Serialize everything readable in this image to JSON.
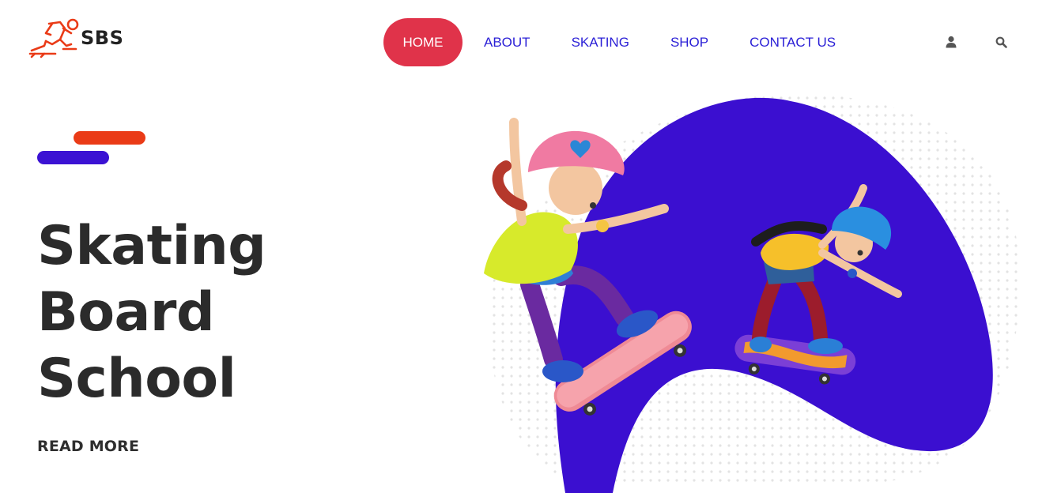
{
  "brand": {
    "name": "SBS",
    "logo_icon": "skater-logo-icon",
    "logo_color": "#ea3b17"
  },
  "nav": {
    "items": [
      {
        "label": "HOME",
        "active": true
      },
      {
        "label": "ABOUT",
        "active": false
      },
      {
        "label": "SKATING",
        "active": false
      },
      {
        "label": "SHOP",
        "active": false
      },
      {
        "label": "CONTACT US",
        "active": false
      }
    ],
    "active_color": "#e0334a",
    "link_color": "#2a1fd6"
  },
  "header_icons": {
    "user": "user-icon",
    "search": "search-icon"
  },
  "hero": {
    "title_lines": [
      "Skating",
      "Board",
      "School"
    ],
    "cta_label": "READ MORE",
    "accent_red": "#ea3b17",
    "accent_blue": "#3b12d3"
  },
  "illustration": {
    "subject": "two-kids-skateboarding",
    "blob_color": "#3b0fd0"
  }
}
